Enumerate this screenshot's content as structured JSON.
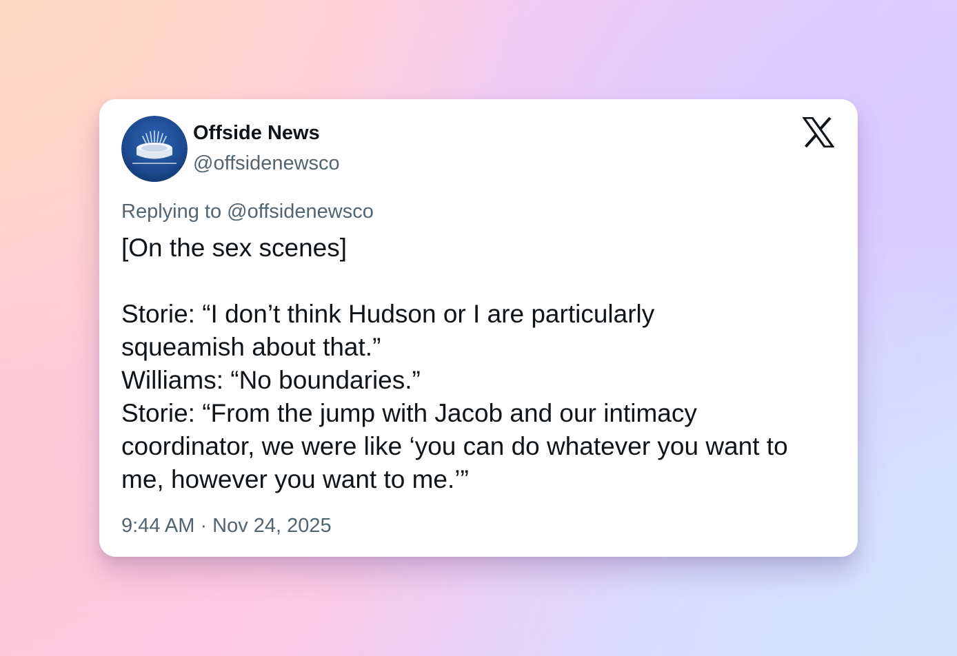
{
  "tweet": {
    "display_name": "Offside News",
    "handle": "@offsidenewsco",
    "replying_to": "Replying to @offsidenewsco",
    "lines": [
      "[On the sex scenes]",
      "",
      "Storie: “I don’t think Hudson or I are particularly",
      "squeamish about that.”",
      "Williams: “No boundaries.”",
      "Storie: “From the jump with Jacob and our intimacy",
      "coordinator, we were like ‘you can do whatever you want to",
      "me, however you want to me.’”"
    ],
    "timestamp": "9:44 AM · Nov 24, 2025"
  },
  "icons": {
    "avatar": "stadium-logo-icon",
    "platform": "x-logo-icon"
  },
  "colors": {
    "text_primary": "#0f1419",
    "text_secondary": "#536471",
    "avatar_blue": "#1f4e96",
    "card_background": "#ffffff"
  }
}
